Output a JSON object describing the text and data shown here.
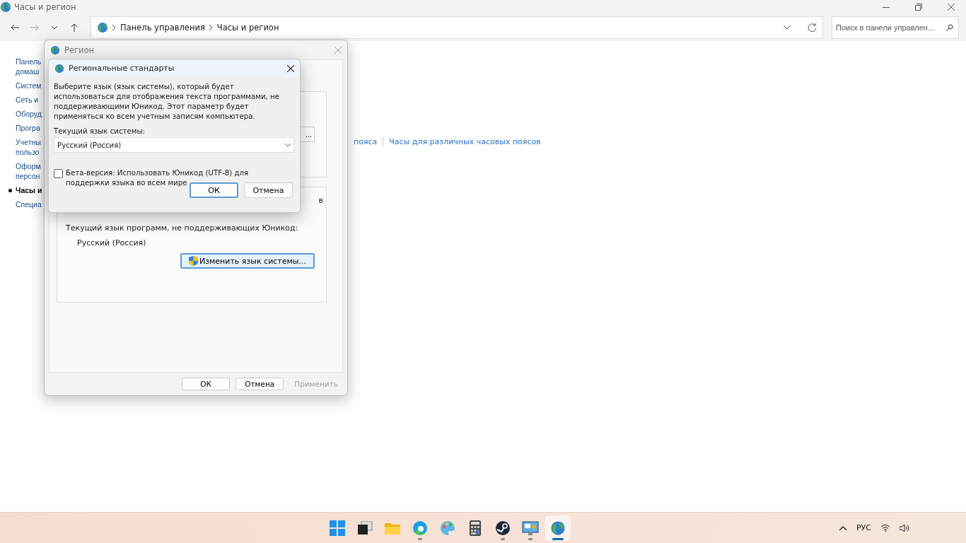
{
  "window": {
    "title": "Часы и регион"
  },
  "breadcrumb": [
    "Панель управления",
    "Часы и регион"
  ],
  "search": {
    "placeholder": "Поиск в панели управлен…"
  },
  "sidebar": {
    "items": [
      {
        "lines": [
          "Панель",
          "домаш"
        ],
        "selected": false
      },
      {
        "lines": [
          "Систем"
        ],
        "selected": false
      },
      {
        "lines": [
          "Сеть и"
        ],
        "selected": false
      },
      {
        "lines": [
          "Оборуд"
        ],
        "selected": false
      },
      {
        "lines": [
          "Програ"
        ],
        "selected": false
      },
      {
        "lines": [
          "Учетны",
          "пользо"
        ],
        "selected": false
      },
      {
        "lines": [
          "Оформ",
          "персон"
        ],
        "selected": false
      },
      {
        "lines": [
          "Часы и"
        ],
        "selected": true
      },
      {
        "lines": [
          "Специа"
        ],
        "selected": false
      }
    ]
  },
  "links": [
    "пояса",
    "Часы для различных часовых поясов"
  ],
  "region_window": {
    "title": "Регион",
    "upper_group": {
      "button": "..."
    },
    "unicode_group": {
      "fragment": "в",
      "label": "Текущий язык программ, не поддерживающих Юникод:",
      "value": "Русский (Россия)",
      "button": "Изменить язык системы..."
    },
    "buttons": [
      {
        "label": "ОК",
        "disabled": false
      },
      {
        "label": "Отмена",
        "disabled": false
      },
      {
        "label": "Применить",
        "disabled": true
      }
    ]
  },
  "dialog": {
    "title": "Региональные стандарты",
    "text": "Выберите язык (язык системы), который будет использоваться для отображения текста программами, не поддерживающими Юникод. Этот параметр будет применяться ко всем учетным записям компьютера.",
    "field_label": "Текущий язык системы:",
    "select": {
      "value": "Русский (Россия)"
    },
    "checkbox": {
      "label": "Бета-версия: Использовать Юникод (UTF-8) для поддержки языка во всем мире",
      "checked": false
    },
    "buttons": [
      {
        "label": "ОК",
        "default": true
      },
      {
        "label": "Отмена",
        "default": false
      }
    ]
  },
  "taskbar": {
    "apps": [
      {
        "kind": "start",
        "running": false,
        "selected": false
      },
      {
        "kind": "taskview",
        "running": false,
        "selected": false
      },
      {
        "kind": "folder",
        "running": false,
        "selected": false
      },
      {
        "kind": "browser",
        "running": true,
        "selected": false
      },
      {
        "kind": "paint",
        "running": false,
        "selected": false
      },
      {
        "kind": "calculator",
        "running": false,
        "selected": false
      },
      {
        "kind": "steam",
        "running": true,
        "selected": false
      },
      {
        "kind": "monitor",
        "running": true,
        "selected": false
      },
      {
        "kind": "globe",
        "running": true,
        "selected": true
      }
    ],
    "language": "РУС"
  }
}
